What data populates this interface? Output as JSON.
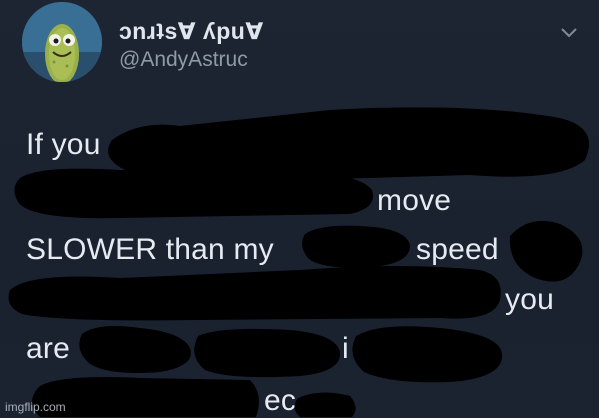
{
  "profile": {
    "display_name": "ɔnɹʇs∀ ʎpu∀",
    "handle": "@AndyAstruc"
  },
  "tweet": {
    "lines": [
      "If you",
      "move",
      "SLOWER than my",
      "speed",
      "you",
      "are",
      "i",
      "ec"
    ]
  },
  "icons": {
    "menu": "chevron-down-icon",
    "avatar": "cartoon-pickle-avatar"
  },
  "watermark": "imgflip.com"
}
